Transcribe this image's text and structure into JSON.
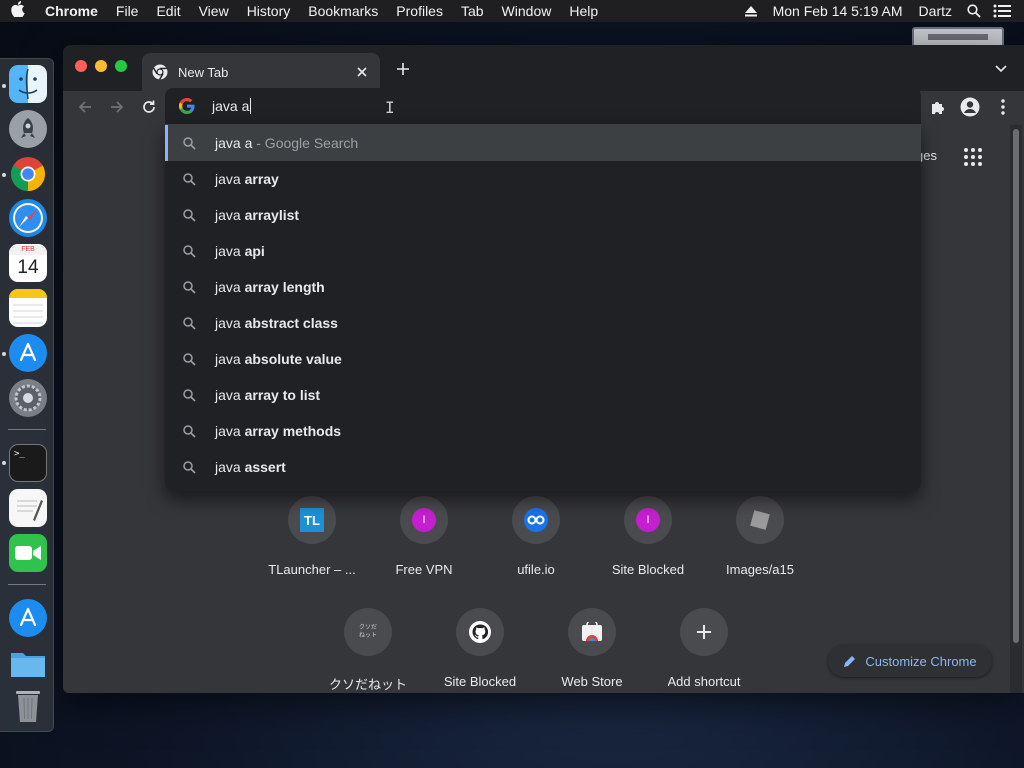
{
  "menubar": {
    "app": "Chrome",
    "items": [
      "File",
      "Edit",
      "View",
      "History",
      "Bookmarks",
      "Profiles",
      "Tab",
      "Window",
      "Help"
    ],
    "datetime": "Mon Feb 14  5:19 AM",
    "user": "Dartz"
  },
  "dock": {
    "calendar_month": "FEB",
    "calendar_day": "14",
    "terminal_prompt": ">_"
  },
  "tab": {
    "title": "New Tab"
  },
  "omnibox": {
    "typed": "java a"
  },
  "suggestions": [
    {
      "typed": "java a",
      "completion": "",
      "suffix": " - Google Search",
      "selected": true
    },
    {
      "typed": "java ",
      "completion": "array",
      "suffix": "",
      "selected": false
    },
    {
      "typed": "java ",
      "completion": "arraylist",
      "suffix": "",
      "selected": false
    },
    {
      "typed": "java ",
      "completion": "api",
      "suffix": "",
      "selected": false
    },
    {
      "typed": "java ",
      "completion": "array length",
      "suffix": "",
      "selected": false
    },
    {
      "typed": "java ",
      "completion": "abstract class",
      "suffix": "",
      "selected": false
    },
    {
      "typed": "java ",
      "completion": "absolute value",
      "suffix": "",
      "selected": false
    },
    {
      "typed": "java ",
      "completion": "array to list",
      "suffix": "",
      "selected": false
    },
    {
      "typed": "java ",
      "completion": "array methods",
      "suffix": "",
      "selected": false
    },
    {
      "typed": "java ",
      "completion": "assert",
      "suffix": "",
      "selected": false
    }
  ],
  "page": {
    "images_link": "ges",
    "customize_label": "Customize Chrome"
  },
  "shortcuts_row1": [
    {
      "label": "TLauncher – ...",
      "icon": "tlauncher-icon",
      "glyph": "TL"
    },
    {
      "label": "Free VPN",
      "icon": "magenta-circle-icon",
      "glyph": "I"
    },
    {
      "label": "ufile.io",
      "icon": "ufile-icon",
      "glyph": ""
    },
    {
      "label": "Site Blocked",
      "icon": "magenta-circle-icon",
      "glyph": "I"
    },
    {
      "label": "Images/a15",
      "icon": "generic-page-icon",
      "glyph": ""
    }
  ],
  "shortcuts_row2": [
    {
      "label": "クソだねット",
      "icon": "kuso-icon",
      "glyph": "クソだ\nねット"
    },
    {
      "label": "Site Blocked",
      "icon": "github-icon",
      "glyph": ""
    },
    {
      "label": "Web Store",
      "icon": "webstore-icon",
      "glyph": ""
    },
    {
      "label": "Add shortcut",
      "icon": "plus-icon",
      "glyph": "+"
    }
  ],
  "colors": {
    "accent": "#8ab4f8",
    "menubar": "#1f1f21",
    "window_bg": "#35363a",
    "omnibox_bg": "#202124"
  }
}
